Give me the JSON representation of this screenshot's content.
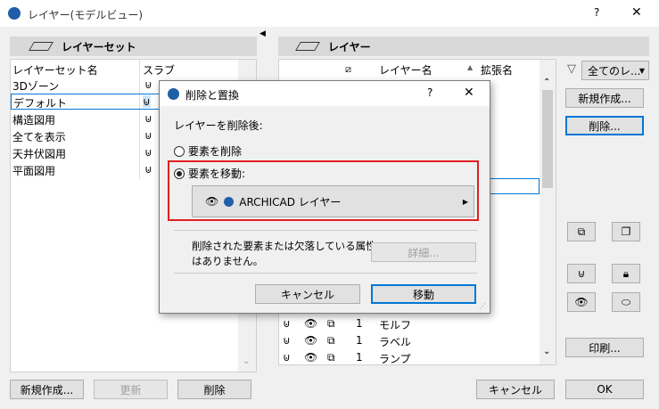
{
  "window": {
    "title": "レイヤー(モデルビュー)",
    "help": "?",
    "close": "✕"
  },
  "layer_sets": {
    "header": "レイヤーセット",
    "col_name": "レイヤーセット名",
    "col_slab": "スラブ",
    "items": [
      "3Dゾーン",
      "デフォルト",
      "構造図用",
      "全てを表示",
      "天井伏図用",
      "平面図用"
    ],
    "new_btn": "新規作成...",
    "update_btn": "更新",
    "delete_btn": "削除"
  },
  "layers": {
    "header": "レイヤー",
    "col_name": "レイヤー名",
    "col_ext": "拡張名",
    "filter_select": "全てのレ...",
    "new_btn": "新規作成...",
    "delete_btn": "削除...",
    "print_btn": "印刷...",
    "rows": [
      {
        "num": "1",
        "name": "モルフ"
      },
      {
        "num": "1",
        "name": "ラベル"
      },
      {
        "num": "1",
        "name": "ランプ"
      }
    ]
  },
  "footer": {
    "cancel": "キャンセル",
    "ok": "OK"
  },
  "dialog": {
    "title": "削除と置換",
    "help": "?",
    "close": "✕",
    "section_label": "レイヤーを削除後:",
    "option_delete": "要素を削除",
    "option_move": "要素を移動:",
    "target_layer": "ARCHICAD レイヤー",
    "info_text_1": "削除された要素または欠落している属性",
    "info_text_2": "はありません。",
    "detail_btn": "詳細...",
    "cancel_btn": "キャンセル",
    "move_btn": "移動"
  }
}
